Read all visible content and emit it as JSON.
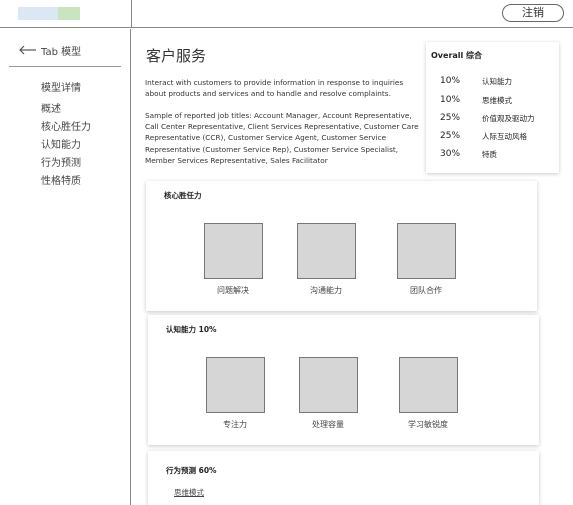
{
  "header": {
    "logout_label": "注销"
  },
  "sidebar": {
    "back_label": "Tab 模型",
    "section_title": "模型详情",
    "items": [
      {
        "label": "概述"
      },
      {
        "label": "核心胜任力"
      },
      {
        "label": "认知能力"
      },
      {
        "label": "行为预测"
      },
      {
        "label": "性格特质"
      }
    ]
  },
  "main": {
    "title": "客户服务",
    "description": "Interact with customers to provide information in response to inquiries about products and services and to handle and resolve complaints.",
    "job_titles": "Sample of reported job titles: Account Manager, Account Representative, Call Center Representative, Client Services Representative, Customer Care Representative (CCR), Customer Service Agent, Customer Service Representative (Customer Service Rep), Customer Service Specialist, Member Services Representative, Sales Facilitator"
  },
  "overall": {
    "title": "Overall 综合",
    "rows": [
      {
        "pct": "10%",
        "label": "认知能力"
      },
      {
        "pct": "10%",
        "label": "思维模式"
      },
      {
        "pct": "25%",
        "label": "价值观及驱动力"
      },
      {
        "pct": "25%",
        "label": "人际互动风格"
      },
      {
        "pct": "30%",
        "label": "特质"
      }
    ]
  },
  "sections": {
    "core": {
      "title": "核心胜任力",
      "tiles": [
        {
          "label": "问题解决"
        },
        {
          "label": "沟通能力"
        },
        {
          "label": "团队合作"
        }
      ]
    },
    "cognitive": {
      "title": "认知能力 10%",
      "tiles": [
        {
          "label": "专注力"
        },
        {
          "label": "处理容量"
        },
        {
          "label": "学习敏锐度"
        }
      ]
    },
    "behavior": {
      "title": "行为预测 60%",
      "link": "思维模式"
    }
  }
}
